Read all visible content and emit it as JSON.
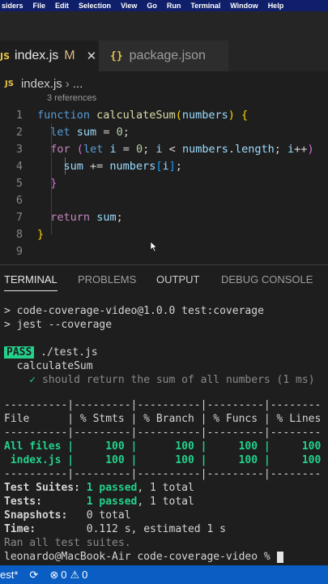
{
  "menubar": {
    "items": [
      "siders",
      "File",
      "Edit",
      "Selection",
      "View",
      "Go",
      "Run",
      "Terminal",
      "Window",
      "Help"
    ]
  },
  "tabs": [
    {
      "label": "index.js",
      "modified_marker": "M",
      "icon": "js-icon",
      "active": true
    },
    {
      "label": "package.json",
      "icon": "json-icon",
      "active": false
    }
  ],
  "breadcrumb": {
    "file": "index.js",
    "rest": "..."
  },
  "editor": {
    "codelens": "3 references",
    "lines": [
      {
        "n": "1"
      },
      {
        "n": "2"
      },
      {
        "n": "3"
      },
      {
        "n": "4"
      },
      {
        "n": "5"
      },
      {
        "n": "6"
      },
      {
        "n": "7"
      },
      {
        "n": "8"
      },
      {
        "n": "9"
      }
    ],
    "tokens": {
      "function_kw": "function",
      "fn_name": "calculateSum",
      "param": "numbers",
      "let": "let",
      "sum": "sum",
      "zero": "0",
      "for": "for",
      "i": "i",
      "numbers": "numbers",
      "length": "length",
      "return": "return"
    }
  },
  "panel": {
    "tabs": [
      "TERMINAL",
      "PROBLEMS",
      "OUTPUT",
      "DEBUG CONSOLE"
    ],
    "active_tab": "TERMINAL"
  },
  "terminal": {
    "line1": "> code-coverage-video@1.0.0 test:coverage",
    "line2": "> jest --coverage",
    "pass": "PASS",
    "test_file": " ./test.js",
    "suite": "  calculateSum",
    "check": "    ✓ ",
    "test_name": "should return the sum of all numbers (1 ms)",
    "rule": "----------|---------|----------|---------|--------",
    "header": "File      | % Stmts | % Branch | % Funcs | % Lines",
    "rows": [
      "All files |     100 |      100 |     100 |     100",
      " index.js |     100 |      100 |     100 |     100"
    ],
    "suites_label": "Test Suites: ",
    "suites_passed": "1 passed",
    "suites_total": ", 1 total",
    "tests_label": "Tests:       ",
    "tests_passed": "1 passed",
    "tests_total": ", 1 total",
    "snapshots_label": "Snapshots:   ",
    "snapshots_value": "0 total",
    "time_label": "Time:        ",
    "time_value": "0.112 s, estimated 1 s",
    "ran": "Ran all test suites.",
    "prompt": "leonardo@MacBook-Air code-coverage-video % "
  },
  "statusbar": {
    "branch": "est*",
    "errors": "0",
    "warnings": "0"
  },
  "colors": {
    "menubar_bg": "#0f1f6a",
    "statusbar_bg": "#0a5dc2",
    "pass_green": "#23d18b"
  }
}
